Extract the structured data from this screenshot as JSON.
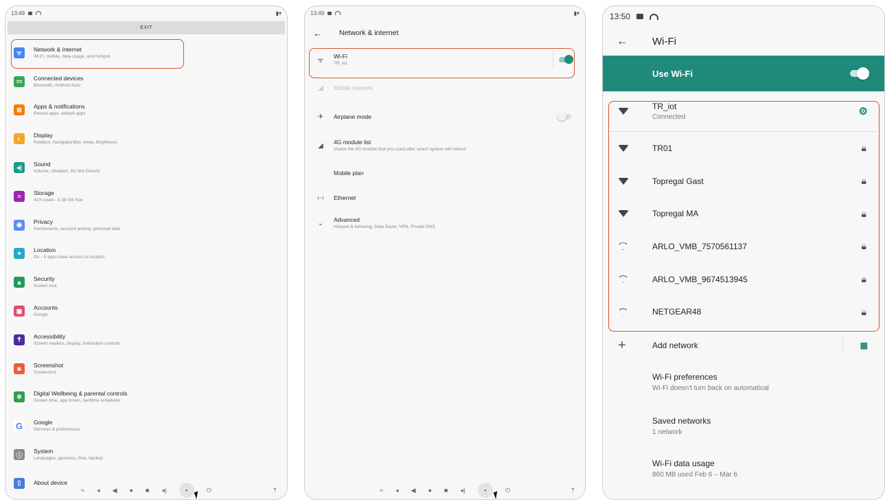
{
  "panel1": {
    "time": "13:49",
    "exit_label": "EXIT",
    "items": [
      {
        "title": "Network & internet",
        "subtitle": "Wi-Fi, mobile, data usage, and hotspot",
        "color": "#4285f4",
        "icon": "wifi-icon"
      },
      {
        "title": "Connected devices",
        "subtitle": "Bluetooth, Android Auto",
        "color": "#34a853",
        "icon": "devices-icon"
      },
      {
        "title": "Apps & notifications",
        "subtitle": "Recent apps, default apps",
        "color": "#f57c00",
        "icon": "apps-icon"
      },
      {
        "title": "Display",
        "subtitle": "Rotation, NavigationBar, sleep, Brightness",
        "color": "#f5a623",
        "icon": "display-icon"
      },
      {
        "title": "Sound",
        "subtitle": "Volume, vibration, Do Not Disturb",
        "color": "#1a9a8a",
        "icon": "sound-icon"
      },
      {
        "title": "Storage",
        "subtitle": "41% used - 9.38 GB free",
        "color": "#9c27b0",
        "icon": "storage-icon"
      },
      {
        "title": "Privacy",
        "subtitle": "Permissions, account activity, personal data",
        "color": "#5c8df6",
        "icon": "privacy-icon"
      },
      {
        "title": "Location",
        "subtitle": "On - 5 apps have access to location",
        "color": "#26a8c9",
        "icon": "location-icon"
      },
      {
        "title": "Security",
        "subtitle": "Screen lock",
        "color": "#1e9a5a",
        "icon": "lock-icon"
      },
      {
        "title": "Accounts",
        "subtitle": "Google",
        "color": "#e04e6a",
        "icon": "accounts-icon"
      },
      {
        "title": "Accessibility",
        "subtitle": "Screen readers, display, interaction controls",
        "color": "#4a2ca0",
        "icon": "accessibility-icon"
      },
      {
        "title": "Screenshot",
        "subtitle": "Screenshot",
        "color": "#ee5a3a",
        "icon": "camera-icon"
      },
      {
        "title": "Digital Wellbeing & parental controls",
        "subtitle": "Screen time, app timers, bedtime schedules",
        "color": "#2e9e4e",
        "icon": "wellbeing-icon"
      },
      {
        "title": "Google",
        "subtitle": "Services & preferences",
        "color": "#ffffff",
        "icon": "google-icon"
      },
      {
        "title": "System",
        "subtitle": "Languages, gestures, time, backup",
        "color": "#8a8a8a",
        "icon": "info-icon"
      },
      {
        "title": "About device",
        "subtitle": "",
        "color": "#4a7adf",
        "icon": "device-icon"
      }
    ]
  },
  "panel2": {
    "time": "13:49",
    "title": "Network & internet",
    "items": [
      {
        "title": "Wi-Fi",
        "subtitle": "TR_iot",
        "icon": "wifi-icon"
      },
      {
        "title": "Mobile network",
        "subtitle": "",
        "icon": "signal-icon"
      },
      {
        "title": "Airplane mode",
        "subtitle": "",
        "icon": "airplane-icon"
      },
      {
        "title": "4G module list",
        "subtitle": "choice the 4G module that you used,after select system will reboot!",
        "icon": "signal-icon"
      },
      {
        "title": "Mobile plan",
        "subtitle": "",
        "icon": ""
      },
      {
        "title": "Ethernet",
        "subtitle": "",
        "icon": "ethernet-icon"
      },
      {
        "title": "Advanced",
        "subtitle": "Hotspot & tethering, Data Saver, VPN, Private DNS",
        "icon": "chevron-down-icon"
      }
    ]
  },
  "panel3": {
    "time": "13:50",
    "title": "Wi-Fi",
    "use_wifi": "Use Wi-Fi",
    "accent": "#1f8a7c",
    "networks": [
      {
        "name": "TR_iot",
        "status": "Connected"
      },
      {
        "name": "TR01"
      },
      {
        "name": "Topregal Gast"
      },
      {
        "name": "Topregal MA"
      },
      {
        "name": "ARLO_VMB_7570561137"
      },
      {
        "name": "ARLO_VMB_9674513945"
      },
      {
        "name": "NETGEAR48"
      }
    ],
    "add_network": "Add network",
    "options": [
      {
        "title": "Wi-Fi preferences",
        "subtitle": "Wi-Fi doesn't turn back on automatical"
      },
      {
        "title": "Saved networks",
        "subtitle": "1 network"
      },
      {
        "title": "Wi-Fi data usage",
        "subtitle": "860 MB used Feb 6 – Mar 6"
      }
    ]
  }
}
